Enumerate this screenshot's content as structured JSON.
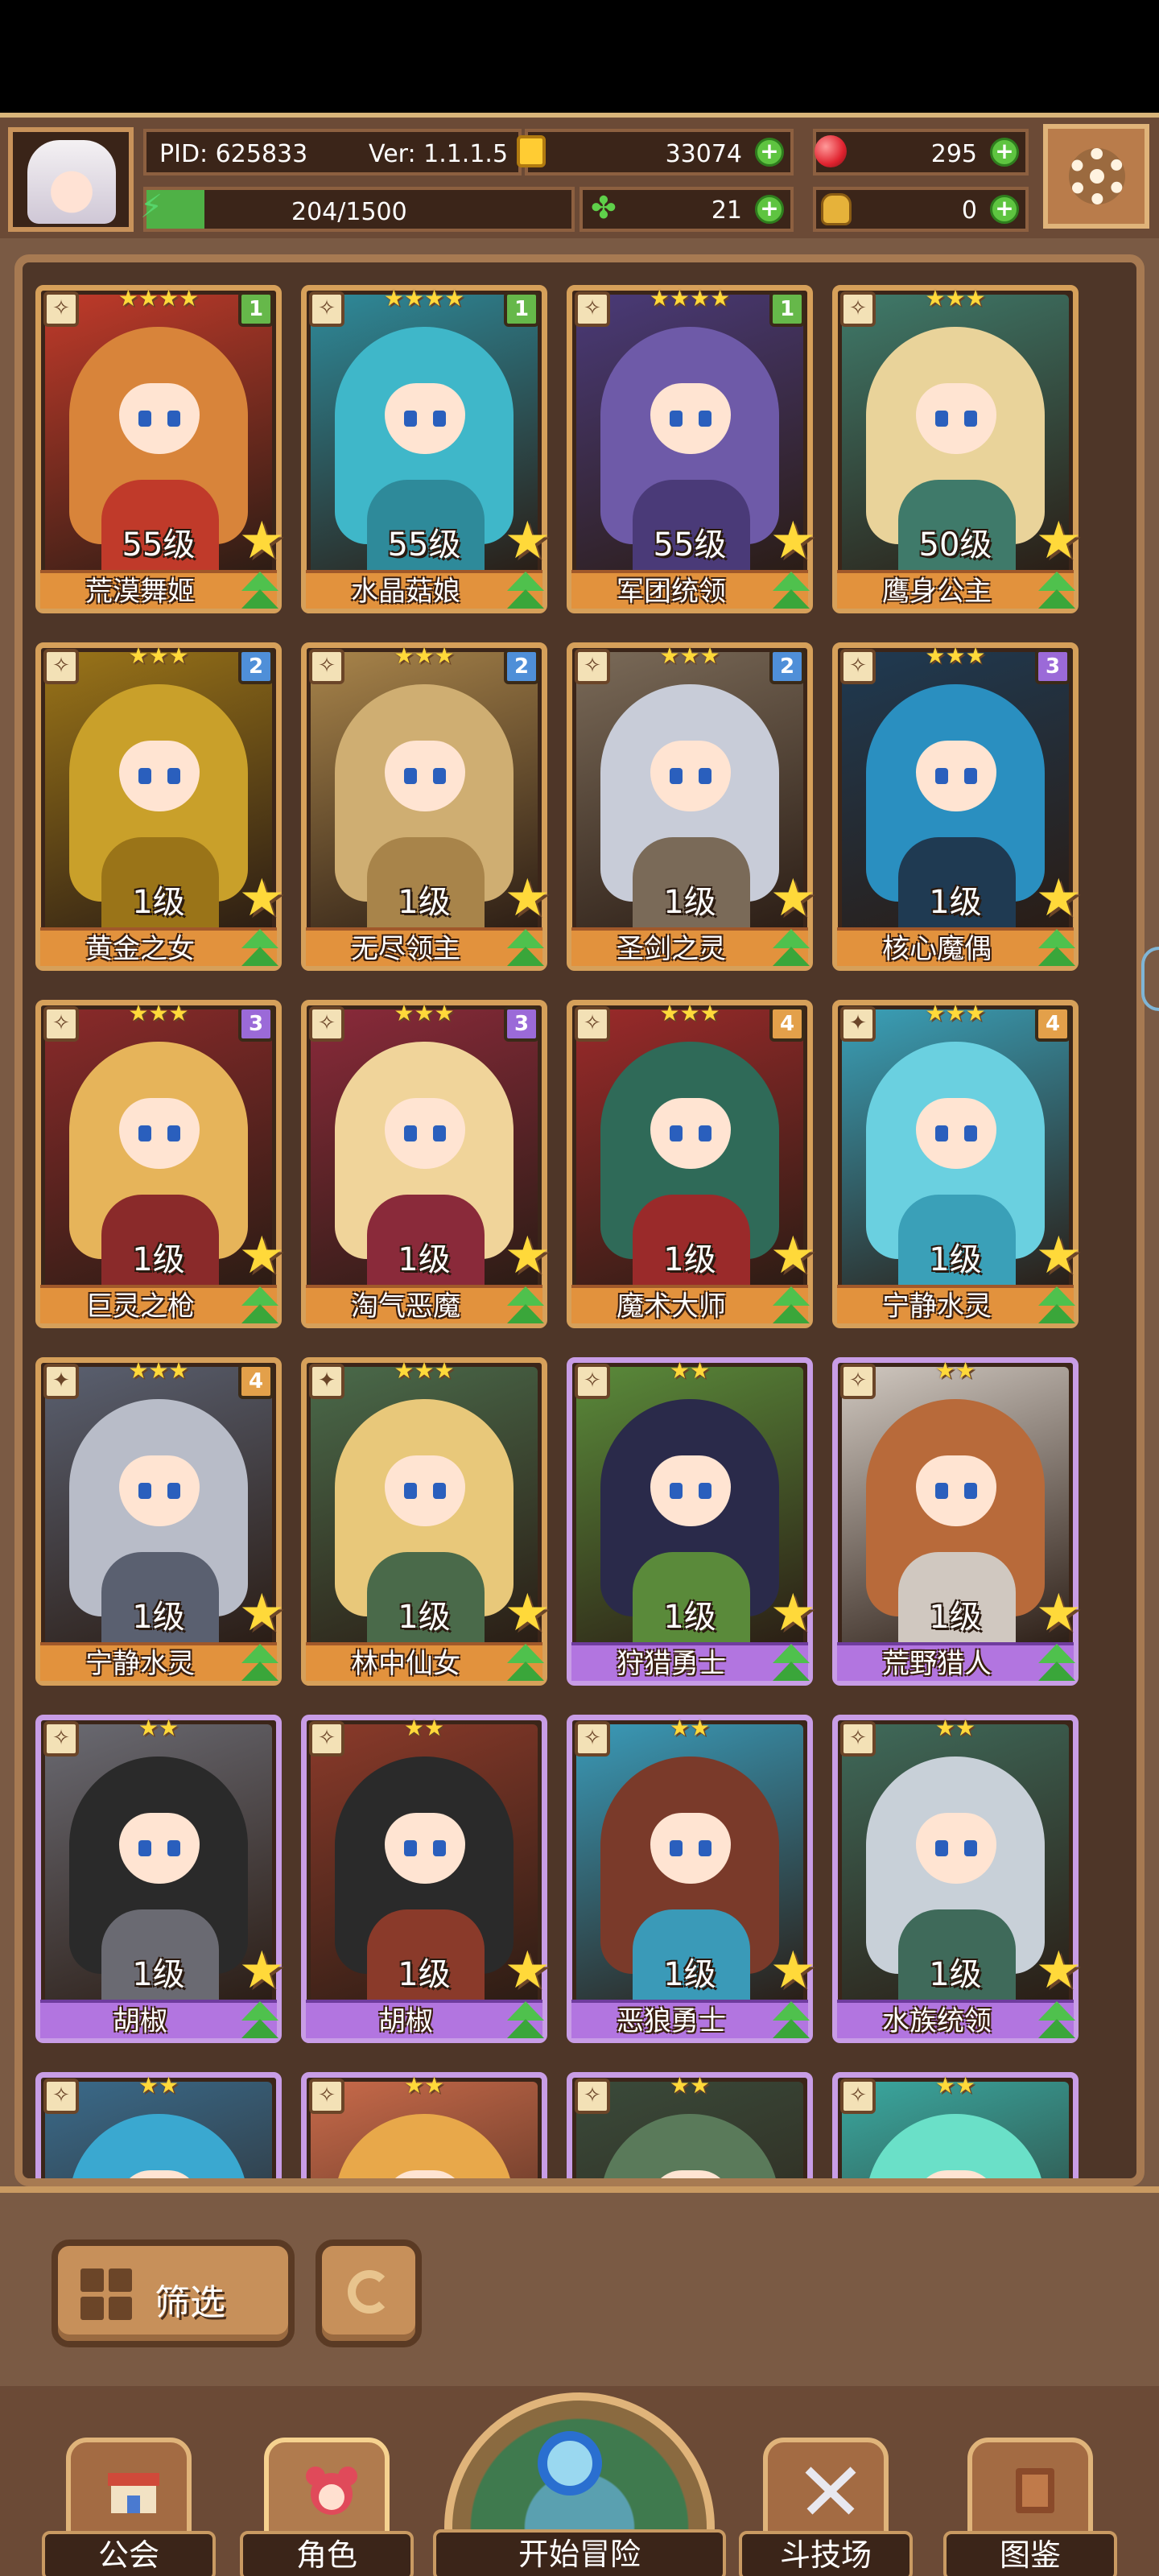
{
  "header": {
    "pid": "PID: 625833",
    "version": "Ver: 1.1.1.5",
    "gold": "33074",
    "gems": "295",
    "clover": "21",
    "bag": "0",
    "energy": "204/1500",
    "energy_fraction": 0.136
  },
  "cards": [
    {
      "level": "55级",
      "name": "荒漠舞姬",
      "tier": "1",
      "stars": "★★★★",
      "type": "✧",
      "rarity": "gold"
    },
    {
      "level": "55级",
      "name": "水晶菇娘",
      "tier": "1",
      "stars": "★★★★",
      "type": "✧",
      "rarity": "gold"
    },
    {
      "level": "55级",
      "name": "军团统领",
      "tier": "1",
      "stars": "★★★★",
      "type": "✧",
      "rarity": "gold"
    },
    {
      "level": "50级",
      "name": "鹰身公主",
      "tier": "",
      "stars": "★★★",
      "type": "✧",
      "rarity": "gold"
    },
    {
      "level": "1级",
      "name": "黄金之女",
      "tier": "2",
      "stars": "★★★",
      "type": "✧",
      "rarity": "gold"
    },
    {
      "level": "1级",
      "name": "无尽领主",
      "tier": "2",
      "stars": "★★★",
      "type": "✧",
      "rarity": "gold"
    },
    {
      "level": "1级",
      "name": "圣剑之灵",
      "tier": "2",
      "stars": "★★★",
      "type": "✧",
      "rarity": "gold"
    },
    {
      "level": "1级",
      "name": "核心魔偶",
      "tier": "3",
      "stars": "★★★",
      "type": "✧",
      "rarity": "gold"
    },
    {
      "level": "1级",
      "name": "巨灵之枪",
      "tier": "3",
      "stars": "★★★",
      "type": "✧",
      "rarity": "gold"
    },
    {
      "level": "1级",
      "name": "淘气恶魔",
      "tier": "3",
      "stars": "★★★",
      "type": "✧",
      "rarity": "gold"
    },
    {
      "level": "1级",
      "name": "魔术大师",
      "tier": "4",
      "stars": "★★★",
      "type": "✧",
      "rarity": "gold"
    },
    {
      "level": "1级",
      "name": "宁静水灵",
      "tier": "4",
      "stars": "★★★",
      "type": "✦",
      "rarity": "gold"
    },
    {
      "level": "1级",
      "name": "宁静水灵",
      "tier": "4",
      "stars": "★★★",
      "type": "✦",
      "rarity": "gold"
    },
    {
      "level": "1级",
      "name": "林中仙女",
      "tier": "",
      "stars": "★★★",
      "type": "✦",
      "rarity": "gold"
    },
    {
      "level": "1级",
      "name": "狩猎勇士",
      "tier": "",
      "stars": "★★",
      "type": "✧",
      "rarity": "purple"
    },
    {
      "level": "1级",
      "name": "荒野猎人",
      "tier": "",
      "stars": "★★",
      "type": "✧",
      "rarity": "purple"
    },
    {
      "level": "1级",
      "name": "胡椒",
      "tier": "",
      "stars": "★★",
      "type": "✧",
      "rarity": "purple"
    },
    {
      "level": "1级",
      "name": "胡椒",
      "tier": "",
      "stars": "★★",
      "type": "✧",
      "rarity": "purple"
    },
    {
      "level": "1级",
      "name": "恶狼勇士",
      "tier": "",
      "stars": "★★",
      "type": "✧",
      "rarity": "purple"
    },
    {
      "level": "1级",
      "name": "水族统领",
      "tier": "",
      "stars": "★★",
      "type": "✧",
      "rarity": "purple"
    },
    {
      "level": "",
      "name": "",
      "tier": "",
      "stars": "★★",
      "type": "✧",
      "rarity": "purple"
    },
    {
      "level": "",
      "name": "",
      "tier": "",
      "stars": "★★",
      "type": "✧",
      "rarity": "purple"
    },
    {
      "level": "",
      "name": "",
      "tier": "",
      "stars": "★★",
      "type": "✧",
      "rarity": "purple"
    },
    {
      "level": "",
      "name": "",
      "tier": "",
      "stars": "★★",
      "type": "✧",
      "rarity": "purple"
    }
  ],
  "card_palettes": [
    [
      "#d8843a",
      "#c03a2a"
    ],
    [
      "#3fb7c9",
      "#2e8a9a"
    ],
    [
      "#6e5aa8",
      "#4a3a78"
    ],
    [
      "#e9d39a",
      "#3f7a6a"
    ],
    [
      "#c9a02a",
      "#9a7418"
    ],
    [
      "#cfae72",
      "#a8844a"
    ],
    [
      "#c8ccd8",
      "#7a6a58"
    ],
    [
      "#2a8fc0",
      "#1f3a52"
    ],
    [
      "#e6b45a",
      "#8a2a2a"
    ],
    [
      "#f0d49a",
      "#8a2a3a"
    ],
    [
      "#2f6a58",
      "#9a2a2a"
    ],
    [
      "#6ad0e0",
      "#3aa0b8"
    ],
    [
      "#b8bcc8",
      "#5a6070"
    ],
    [
      "#e8c87a",
      "#4a6a4a"
    ],
    [
      "#2a2a4a",
      "#5a8a3a"
    ],
    [
      "#b86a3a",
      "#d0c8c0"
    ],
    [
      "#2a2a2a",
      "#6a6a72"
    ],
    [
      "#2a2a2a",
      "#8a3a2a"
    ],
    [
      "#7a3a2a",
      "#3a9ab8"
    ],
    [
      "#c8d0d8",
      "#3f6a5a"
    ],
    [
      "#3aa8d0",
      "#3a6a8a"
    ],
    [
      "#e8a84a",
      "#c86a4a"
    ],
    [
      "#5a7a5a",
      "#3a4a3a"
    ],
    [
      "#6ae0c8",
      "#3aa8a0"
    ]
  ],
  "bottom": {
    "filter_label": "筛选"
  },
  "nav": {
    "guild": "公会",
    "roles": "角色",
    "adventure": "开始冒险",
    "arena": "斗技场",
    "codex": "图鉴"
  }
}
